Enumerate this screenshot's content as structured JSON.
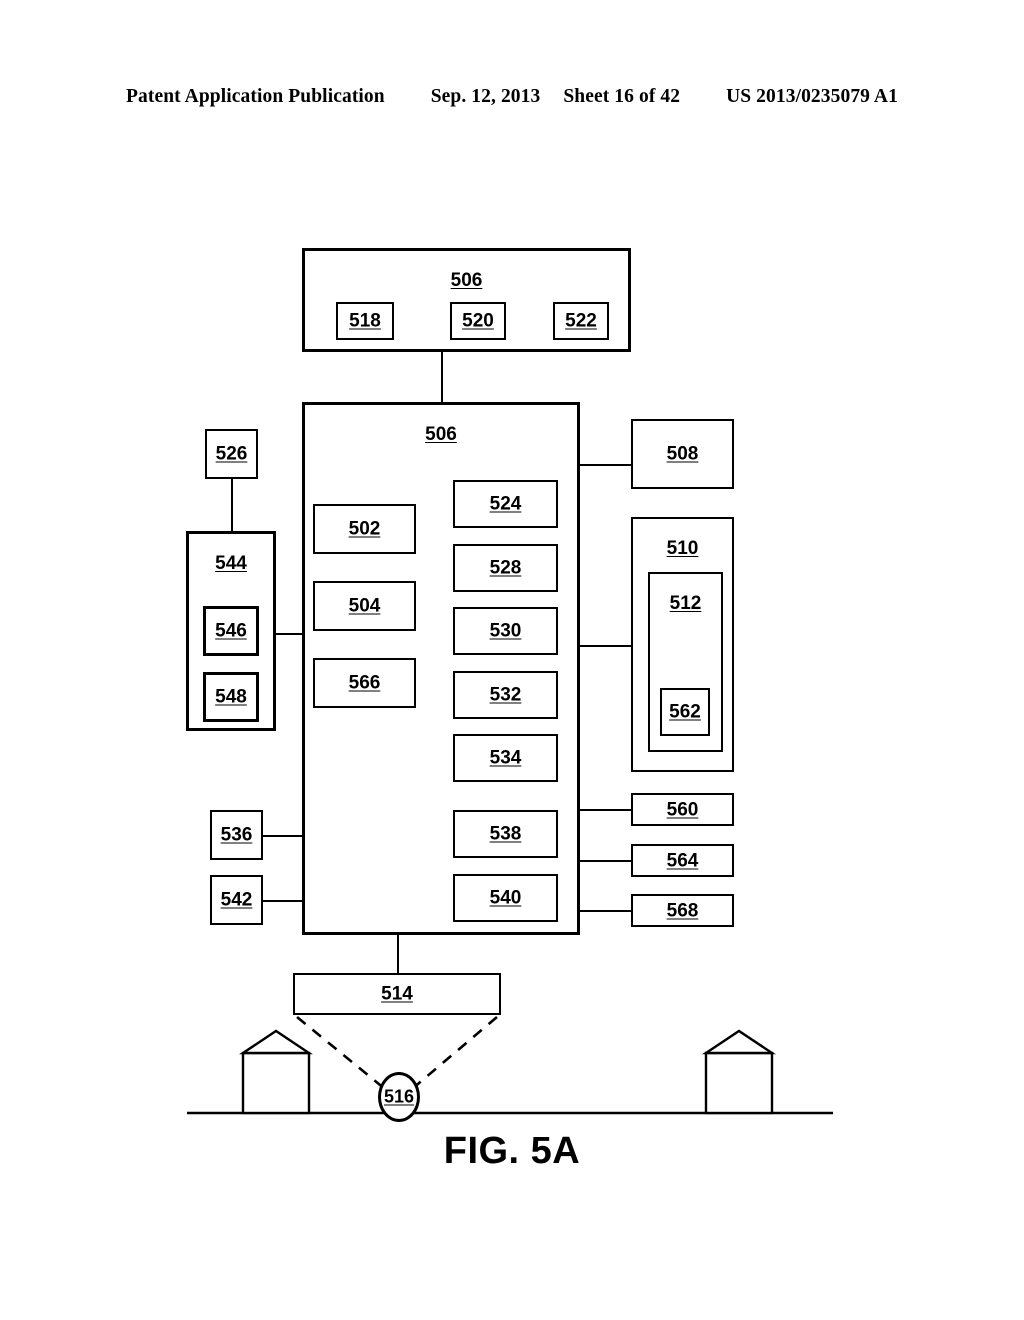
{
  "header": {
    "publication": "Patent Application Publication",
    "date": "Sep. 12, 2013",
    "sheet": "Sheet 16 of 42",
    "patent_number": "US 2013/0235079 A1"
  },
  "figure": {
    "caption": "FIG. 5A"
  },
  "diagram": {
    "top_module": {
      "label": "506",
      "children": [
        {
          "label": "518"
        },
        {
          "label": "520"
        },
        {
          "label": "522"
        }
      ]
    },
    "main_module": {
      "label": "506",
      "left_column": [
        {
          "label": "502"
        },
        {
          "label": "504"
        },
        {
          "label": "566"
        }
      ],
      "right_column": [
        {
          "label": "524"
        },
        {
          "label": "528"
        },
        {
          "label": "530"
        },
        {
          "label": "532"
        },
        {
          "label": "534"
        },
        {
          "label": "538"
        },
        {
          "label": "540"
        }
      ]
    },
    "left_side": {
      "top_box": {
        "label": "526"
      },
      "container": {
        "label": "544",
        "children": [
          {
            "label": "546"
          },
          {
            "label": "548"
          }
        ]
      },
      "lower_boxes": [
        {
          "label": "536"
        },
        {
          "label": "542"
        }
      ]
    },
    "right_side": {
      "top_box": {
        "label": "508"
      },
      "container": {
        "label": "510",
        "child": {
          "label": "512",
          "child": {
            "label": "562"
          }
        }
      },
      "lower_boxes": [
        {
          "label": "560"
        },
        {
          "label": "564"
        },
        {
          "label": "568"
        }
      ]
    },
    "bottom": {
      "emitter": {
        "label": "514"
      },
      "target": {
        "label": "516"
      },
      "scene": {
        "house_left": "house-icon",
        "house_right": "house-icon",
        "ground": "ground-line"
      }
    }
  },
  "colors": {
    "stroke": "#000000",
    "background": "#ffffff"
  }
}
